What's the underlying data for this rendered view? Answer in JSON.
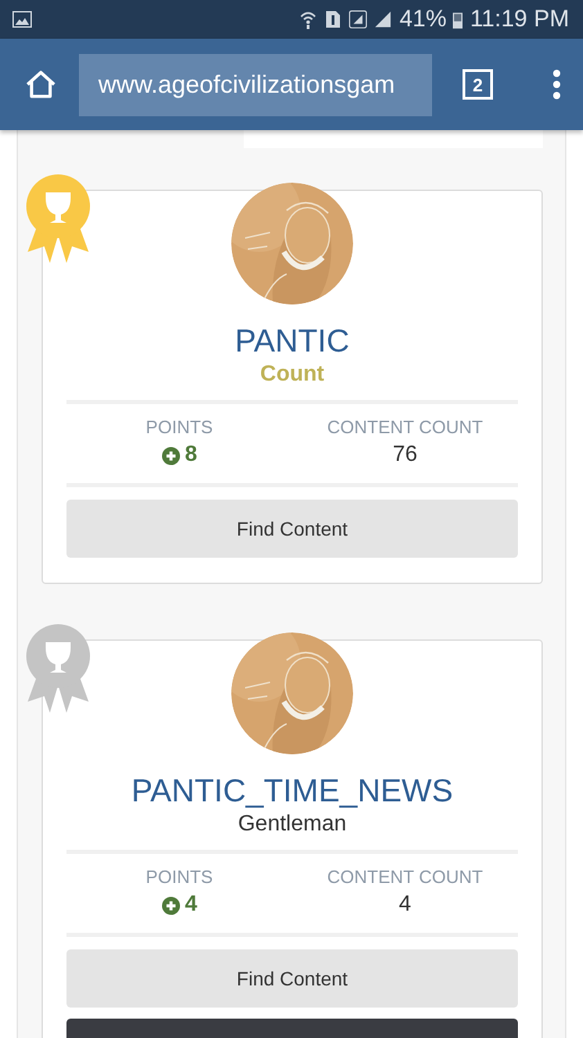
{
  "status_bar": {
    "battery": "41%",
    "time": "11:19 PM"
  },
  "browser": {
    "url": "www.ageofcivilizationsgam",
    "tab_count": "2"
  },
  "members": [
    {
      "color": "#f9c846",
      "name": "PANTIC",
      "rank_title": {
        "text": "Count",
        "color": "#bfb257"
      },
      "points_label": "POINTS",
      "points": "8",
      "content_label": "CONTENT COUNT",
      "content_count": "76",
      "button": "Find Content"
    },
    {
      "color": "#c4c4c4",
      "name": "PANTIC_TIME_NEWS",
      "rank_title": {
        "text": "Gentleman",
        "color": "#333333"
      },
      "points_label": "POINTS",
      "points": "4",
      "content_label": "CONTENT COUNT",
      "content_count": "4",
      "button": "Find Content"
    }
  ]
}
